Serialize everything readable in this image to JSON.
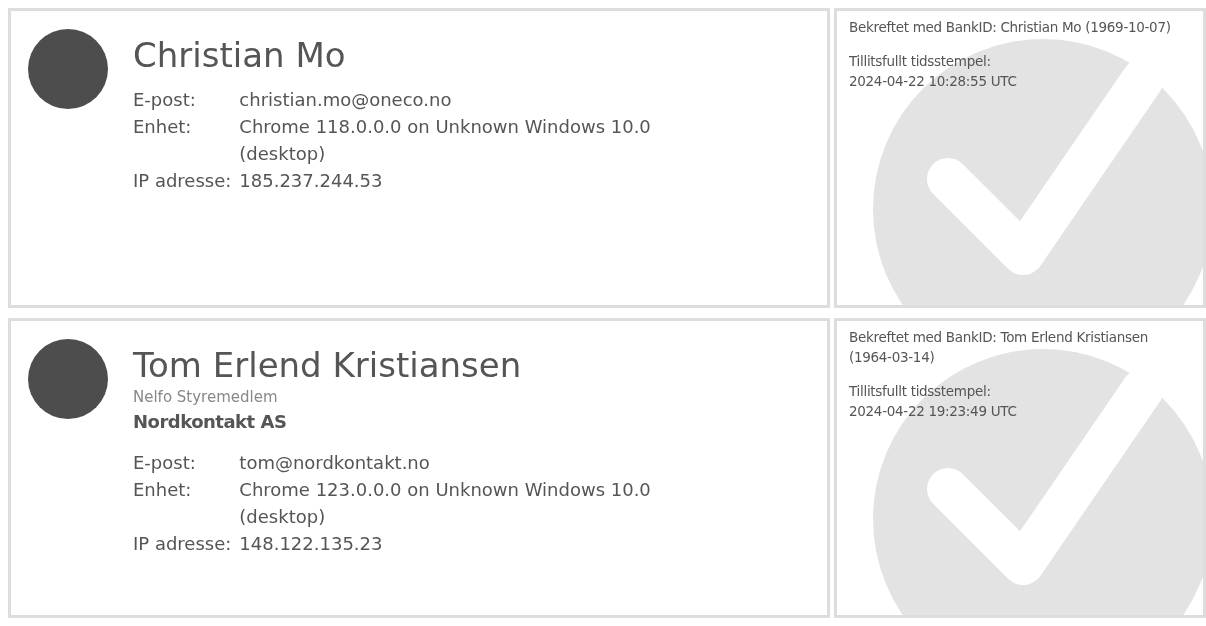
{
  "signers": [
    {
      "name": "Christian Mo",
      "fields": [
        {
          "label": "E-post:",
          "value": "christian.mo@oneco.no"
        },
        {
          "label": "Enhet:",
          "value": "Chrome 118.0.0.0 on Unknown Windows 10.0 (desktop)"
        },
        {
          "label": "IP adresse:",
          "value": "185.237.244.53"
        }
      ],
      "verification": "Bekreftet med BankID: Christian Mo (1969-10-07)",
      "timestamp_label": "Tillitsfullt tidsstempel:",
      "timestamp": "2024-04-22 10:28:55 UTC"
    },
    {
      "name": "Tom Erlend Kristiansen",
      "role": "Nelfo Styremedlem",
      "company": "Nordkontakt AS",
      "fields": [
        {
          "label": "E-post:",
          "value": "tom@nordkontakt.no"
        },
        {
          "label": "Enhet:",
          "value": "Chrome 123.0.0.0 on Unknown Windows 10.0 (desktop)"
        },
        {
          "label": "IP adresse:",
          "value": "148.122.135.23"
        }
      ],
      "verification": "Bekreftet med BankID: Tom Erlend Kristiansen (1964-03-14)",
      "timestamp_label": "Tillitsfullt tidsstempel:",
      "timestamp": "2024-04-22 19:23:49 UTC"
    }
  ]
}
